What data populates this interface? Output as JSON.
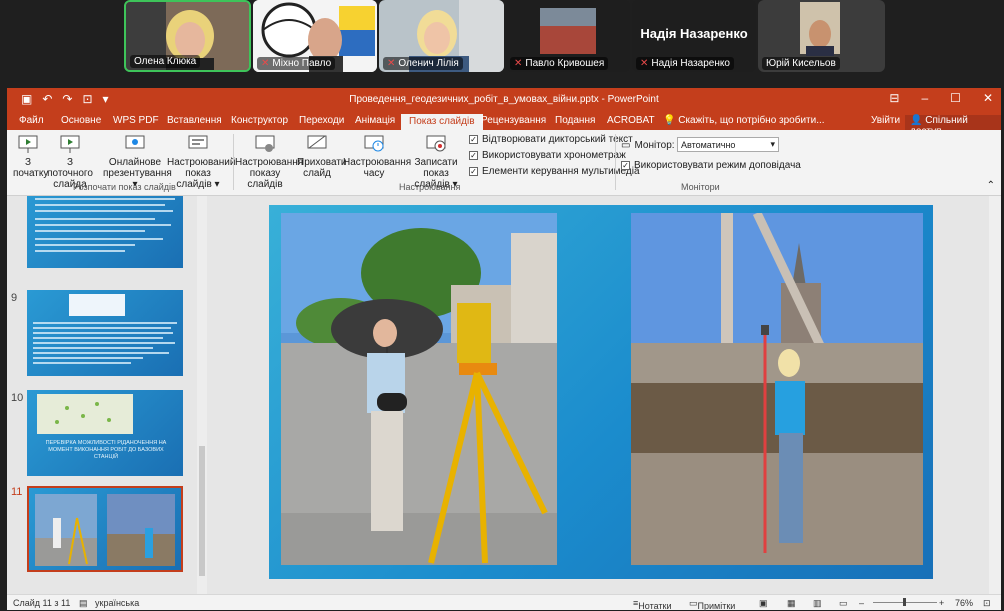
{
  "participants": [
    {
      "name": "Олена Клюка",
      "muted": false,
      "active": true
    },
    {
      "name": "Міхно Павло",
      "muted": true
    },
    {
      "name": "Оленич Лілія",
      "muted": true
    },
    {
      "name": "Павло Кривошея",
      "muted": true
    },
    {
      "name": "Надія Назаренко",
      "muted": true,
      "big_name": "Надія Назаренко"
    },
    {
      "name": "Юрій Кисельов",
      "muted": false
    }
  ],
  "window": {
    "title": "Проведення_геодезичних_робіт_в_умовах_війни.pptx - PowerPoint",
    "signin": "Увійти",
    "share": "Спільний доступ"
  },
  "tabs": [
    "Файл",
    "Основне",
    "WPS PDF",
    "Вставлення",
    "Конструктор",
    "Переходи",
    "Анімація",
    "Показ слайдів",
    "Рецензування",
    "Подання",
    "ACROBAT"
  ],
  "active_tab": "Показ слайдів",
  "tell_me": "Скажіть, що потрібно зробити...",
  "ribbon": {
    "from_start": "З початку",
    "from_current": "З поточного слайда",
    "present_online": "Онлайнове презентування",
    "custom_show": "Настроюваний показ слайдів",
    "group_start": "Розпочати показ слайдів",
    "setup_show": "Настроювання показу слайдів",
    "hide_slide": "Приховати слайд",
    "rehearse": "Настроювання часу",
    "record": "Записати показ слайдів",
    "play_narrations": "Відтворювати дикторський текст",
    "use_timings": "Використовувати хронометраж",
    "media_controls": "Елементи керування мультимедіа",
    "group_setup": "Настроювання",
    "monitor_label": "Монітор:",
    "monitor_value": "Автоматично",
    "presenter_view": "Використовувати режим доповідача",
    "group_monitors": "Монітори"
  },
  "thumbnails": {
    "numbers": [
      "9",
      "10",
      "11"
    ],
    "slide10_caption": "ПЕРЕВІРКА МОЖЛИВОСТІ РІДАНОЧЕННЯ НА МОМЕНТ ВИКОНАННЯ РОБІТ ДО БАЗОВИХ СТАНЦІЙ"
  },
  "status": {
    "slide_counter": "Слайд 11 з 11",
    "language": "українська",
    "notes": "Нотатки",
    "comments": "Примітки",
    "zoom": "76%"
  },
  "colors": {
    "accent": "#c43e1c",
    "slide_bg": "#1b8ccd"
  }
}
